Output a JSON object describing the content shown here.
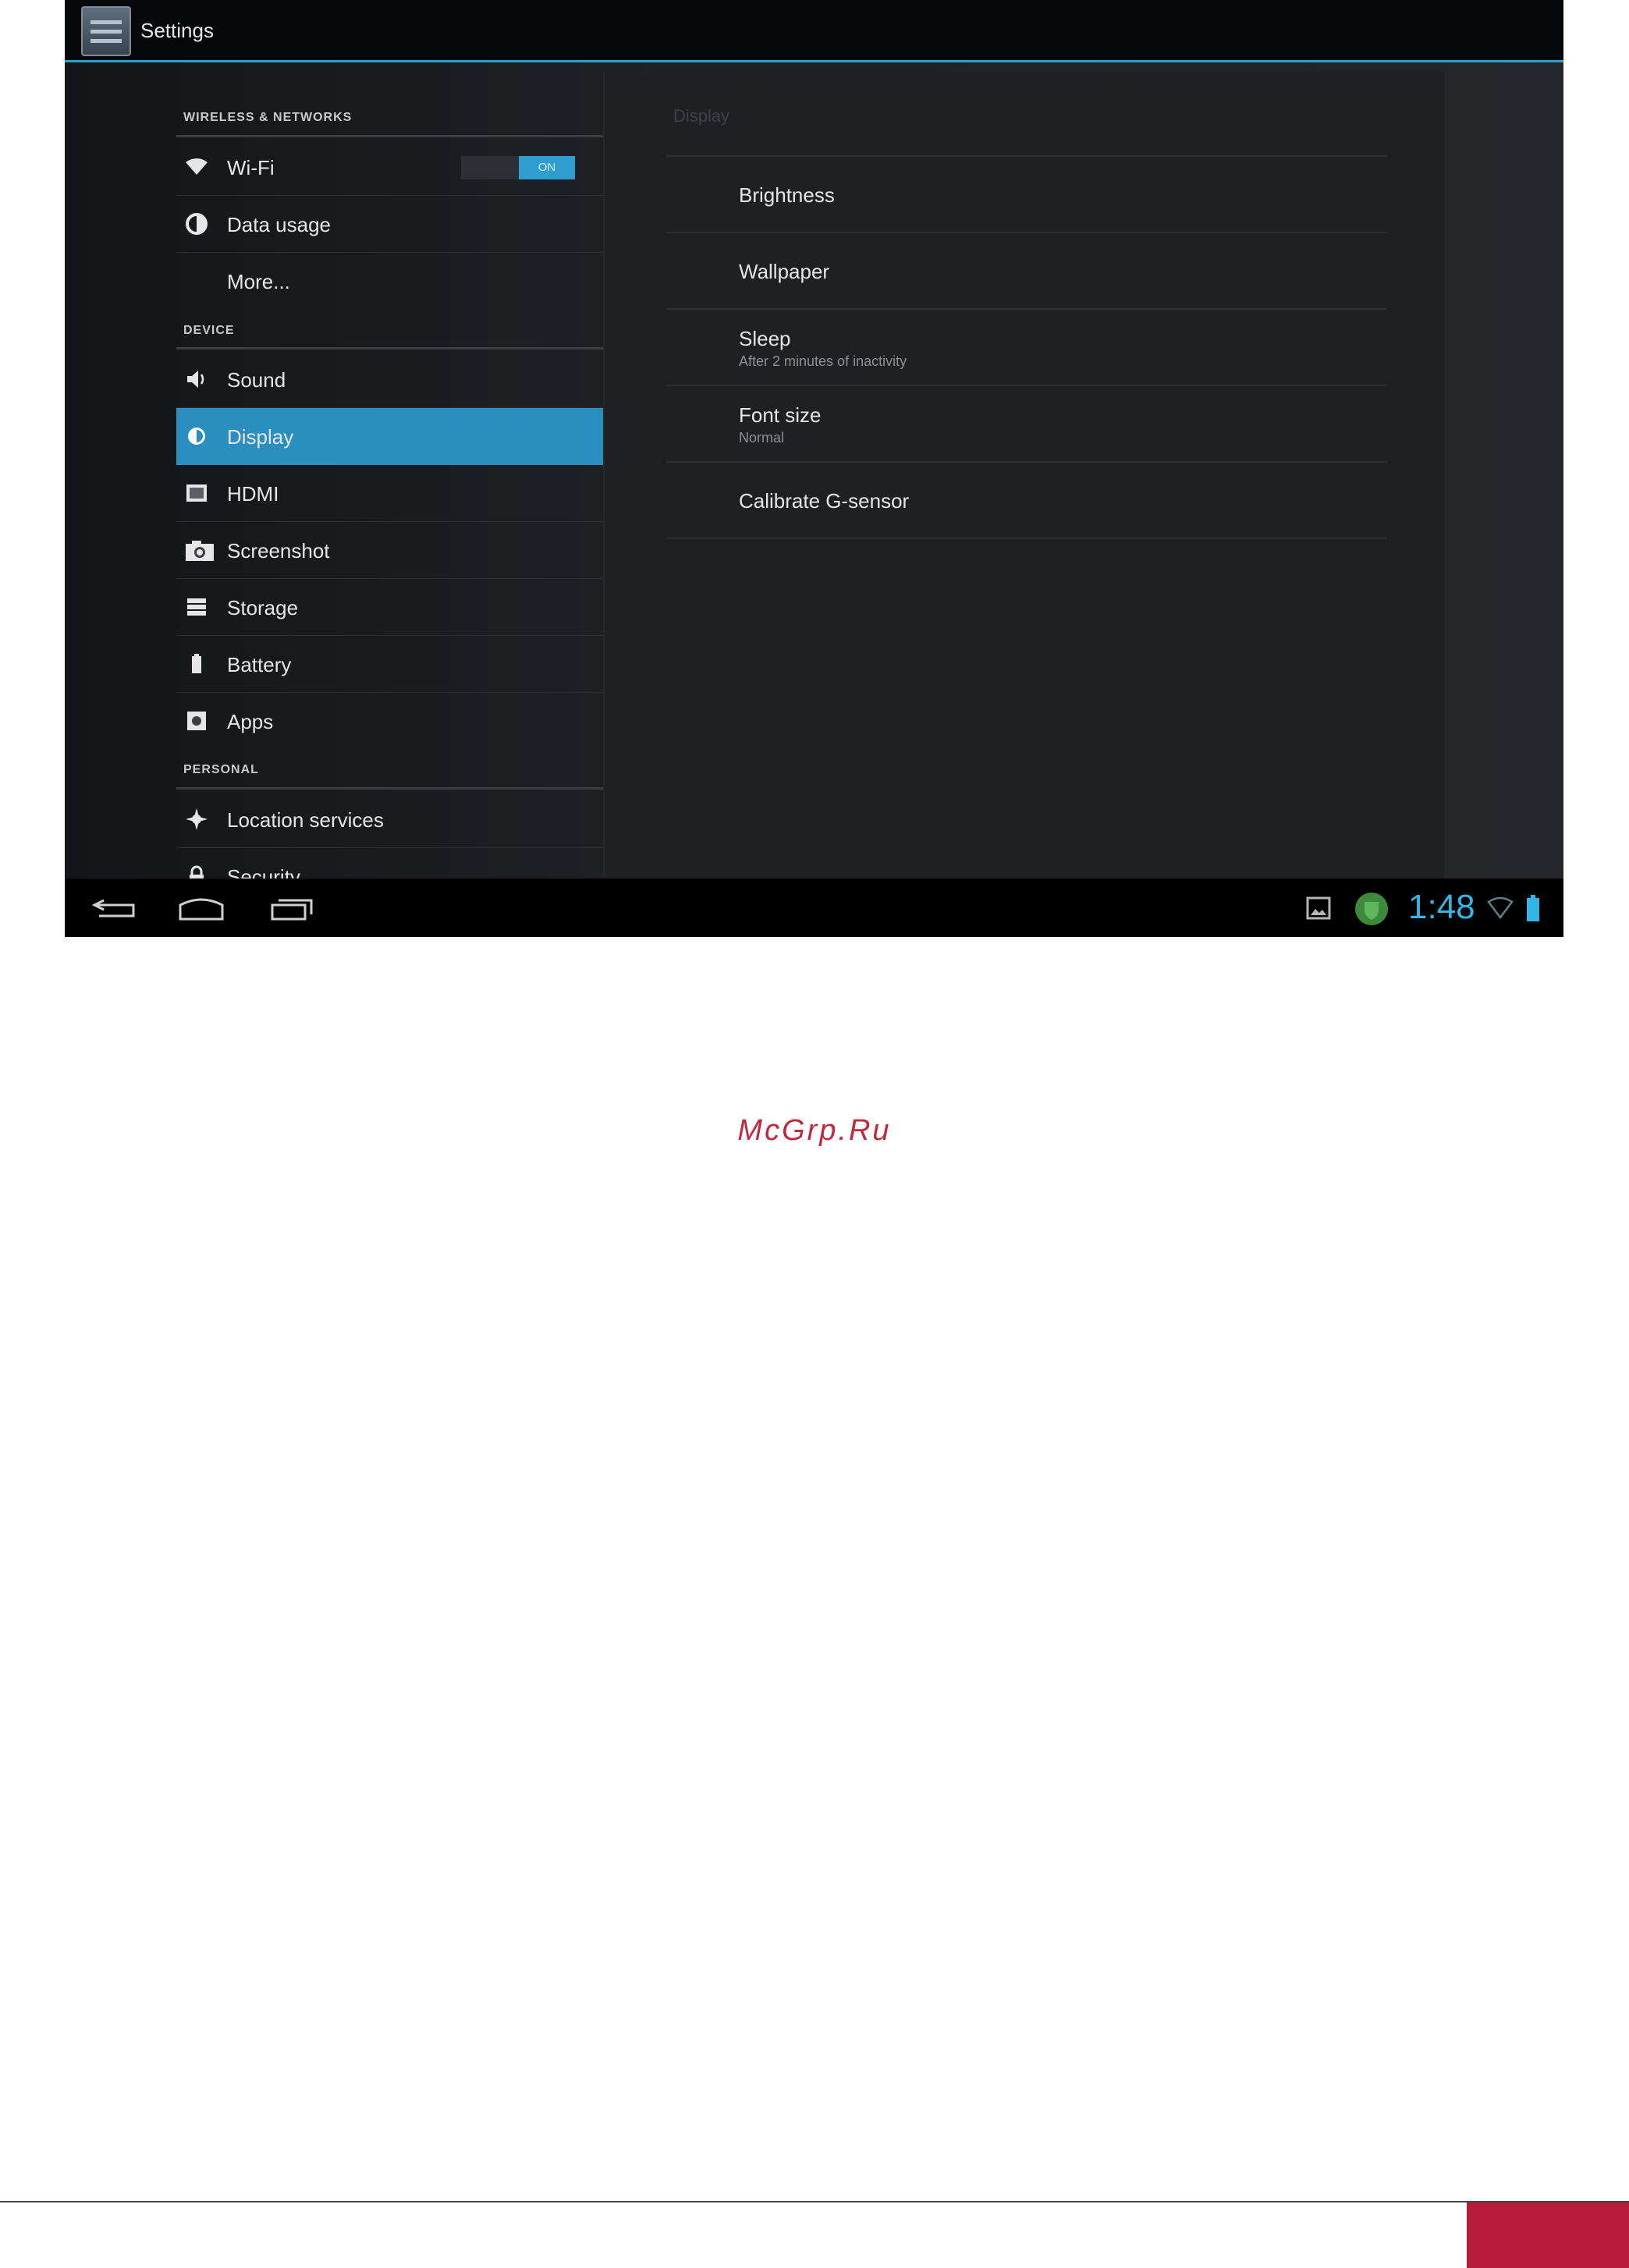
{
  "action_bar": {
    "title": "Settings",
    "icon": "settings-app-icon"
  },
  "left_pane": {
    "headers": {
      "wireless": "WIRELESS & NETWORKS",
      "device": "DEVICE",
      "personal": "PERSONAL"
    },
    "wifi": {
      "label": "Wi-Fi",
      "toggle": "ON"
    },
    "data_usage": {
      "label": "Data usage"
    },
    "more": {
      "label": "More..."
    },
    "sound": {
      "label": "Sound"
    },
    "display": {
      "label": "Display"
    },
    "hdmi": {
      "label": "HDMI"
    },
    "screenshot": {
      "label": "Screenshot"
    },
    "storage": {
      "label": "Storage"
    },
    "battery": {
      "label": "Battery"
    },
    "apps": {
      "label": "Apps"
    },
    "location": {
      "label": "Location services"
    },
    "security": {
      "label": "Security"
    },
    "selected": "Display"
  },
  "right_pane": {
    "title": "Display",
    "brightness": {
      "title": "Brightness"
    },
    "wallpaper": {
      "title": "Wallpaper"
    },
    "sleep": {
      "title": "Sleep",
      "summary": "After 2 minutes of inactivity"
    },
    "font_size": {
      "title": "Font size",
      "summary": "Normal"
    },
    "calibrate": {
      "title": "Calibrate G-sensor"
    }
  },
  "status_bar": {
    "time": "1:48"
  },
  "colors": {
    "accent": "#33b5e5",
    "selected_row": "#2a8fbf",
    "watermark": "#c0283b",
    "footer_tab": "#b91c3b"
  },
  "watermark": "McGrp.Ru"
}
